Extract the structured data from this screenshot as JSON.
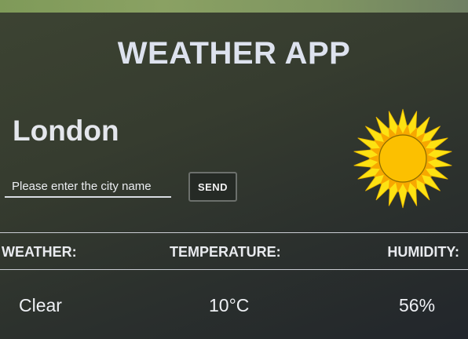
{
  "app": {
    "title": "WEATHER APP"
  },
  "city": {
    "name": "London"
  },
  "search": {
    "placeholder": "Please enter the city name",
    "value": "",
    "send_label": "SEND"
  },
  "icon": {
    "condition_icon": "sun-icon"
  },
  "table": {
    "headers": {
      "weather": "WEATHER:",
      "temperature": "TEMPERATURE:",
      "humidity": "HUMIDITY:"
    },
    "values": {
      "weather": "Clear",
      "temperature": "10°C",
      "humidity": "56%"
    }
  },
  "colors": {
    "title_text": "#dde2ee",
    "sun_outer": "#fde212",
    "sun_core": "#fcc000",
    "panel_dark": "#22262c"
  }
}
